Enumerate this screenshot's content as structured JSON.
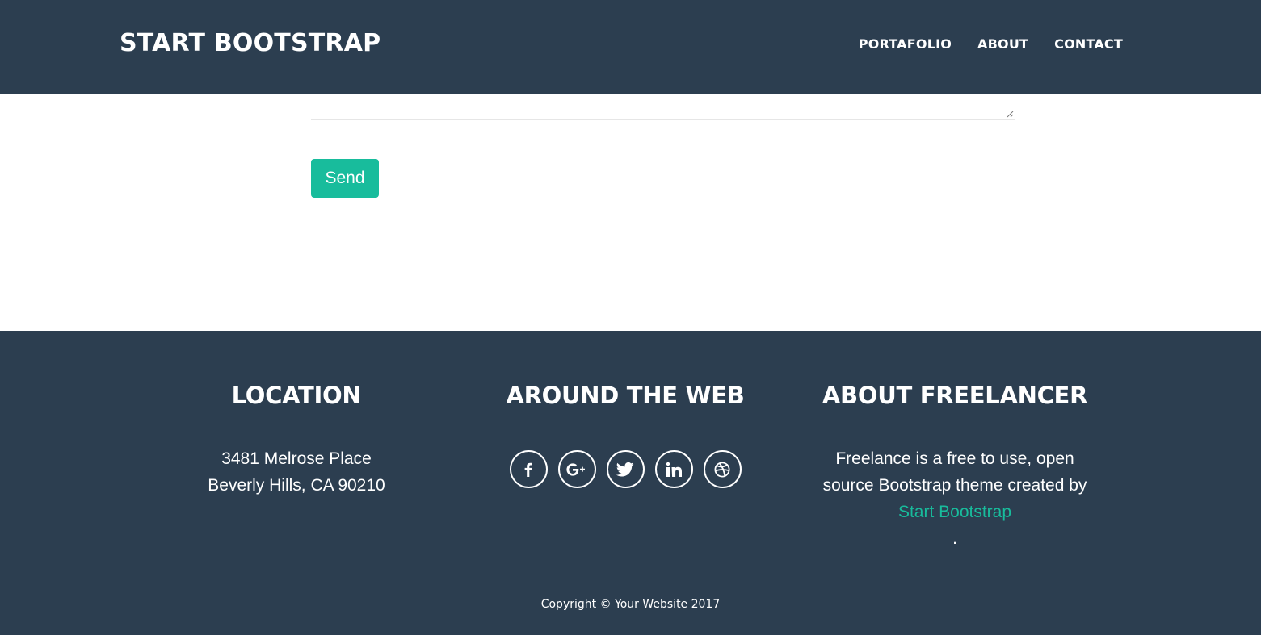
{
  "navbar": {
    "brand": "START BOOTSTRAP",
    "links": [
      {
        "label": "PORTAFOLIO"
      },
      {
        "label": "ABOUT"
      },
      {
        "label": "CONTACT"
      }
    ]
  },
  "contact": {
    "send_label": "Send"
  },
  "footer": {
    "location": {
      "title": "LOCATION",
      "line1": "3481 Melrose Place",
      "line2": "Beverly Hills, CA 90210"
    },
    "web": {
      "title": "AROUND THE WEB",
      "icons": [
        "facebook-icon",
        "google-plus-icon",
        "twitter-icon",
        "linkedin-icon",
        "dribbble-icon"
      ]
    },
    "about": {
      "title": "ABOUT FREELANCER",
      "text_before": "Freelance is a free to use, open source Bootstrap theme created by ",
      "link_text": "Start Bootstrap",
      "text_after": "."
    },
    "copyright": "Copyright © Your Website 2017"
  },
  "colors": {
    "navy": "#2c3e50",
    "accent": "#18bc9c",
    "white": "#ffffff"
  }
}
